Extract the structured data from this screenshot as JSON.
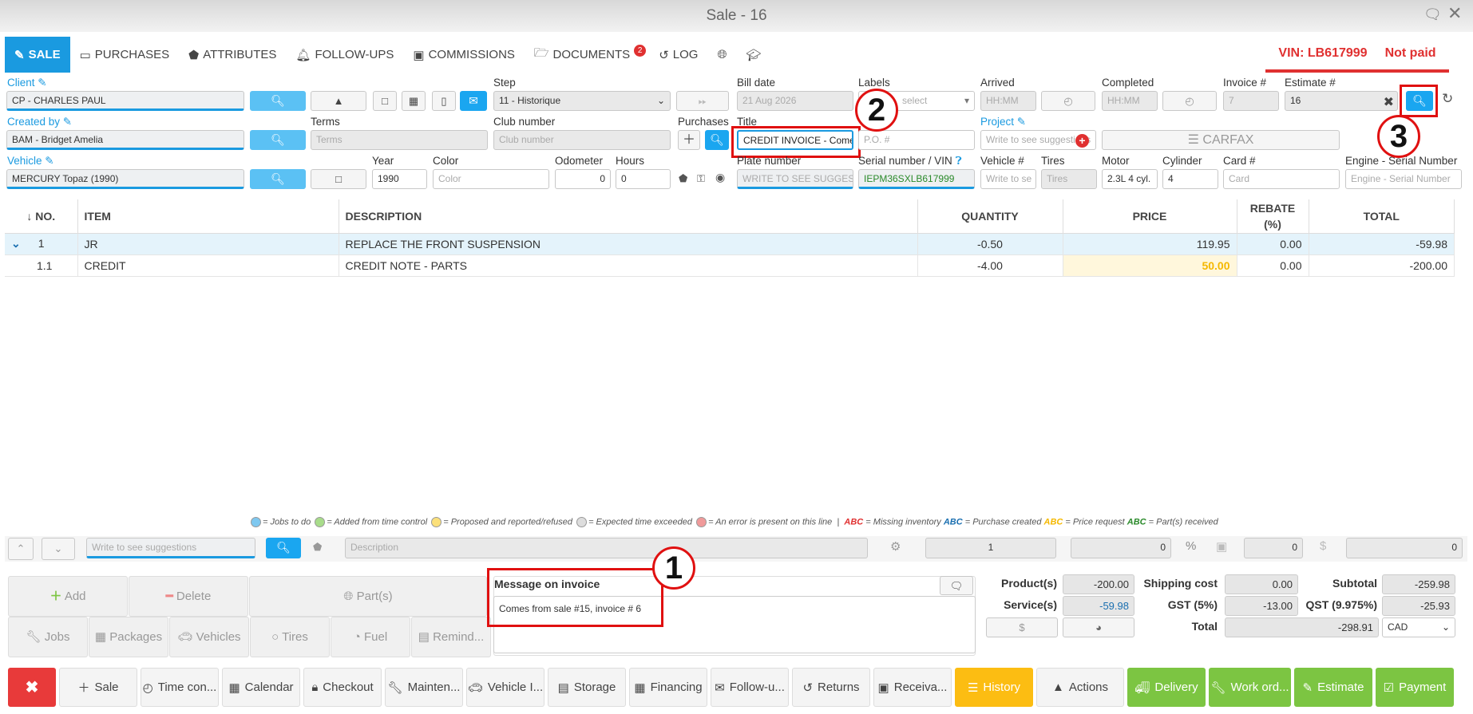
{
  "window": {
    "title": "Sale - 16"
  },
  "tabs": [
    {
      "label": "SALE",
      "icon": "edit-icon"
    },
    {
      "label": "PURCHASES",
      "icon": "credit-card-icon"
    },
    {
      "label": "ATTRIBUTES",
      "icon": "tags-icon"
    },
    {
      "label": "FOLLOW-UPS",
      "icon": "bell-icon"
    },
    {
      "label": "COMMISSIONS",
      "icon": "money-icon"
    },
    {
      "label": "DOCUMENTS",
      "icon": "folder-icon",
      "badge": "2"
    },
    {
      "label": "LOG",
      "icon": "history-icon"
    }
  ],
  "status": {
    "vin": "VIN: LB617999",
    "payment": "Not paid"
  },
  "form": {
    "client_label": "Client",
    "client_value": "CP - CHARLES PAUL",
    "step_label": "Step",
    "step_value": "11 - Historique",
    "bill_date_label": "Bill date",
    "bill_date_value": "21 Aug 2026",
    "labels_label": "Labels",
    "labels_placeholder": "select",
    "arrived_label": "Arrived",
    "arrived_placeholder": "HH:MM",
    "completed_label": "Completed",
    "completed_placeholder": "HH:MM",
    "invoice_label": "Invoice #",
    "invoice_value": "7",
    "estimate_label": "Estimate #",
    "estimate_value": "16",
    "created_by_label": "Created by",
    "created_by_value": "BAM - Bridget Amelia",
    "terms_label": "Terms",
    "terms_placeholder": "Terms",
    "club_label": "Club number",
    "club_placeholder": "Club number",
    "purchases_label": "Purchases",
    "title_label": "Title",
    "title_value": "CREDIT INVOICE - Come",
    "po_placeholder": "P.O. #",
    "project_label": "Project",
    "project_placeholder": "Write to see suggestions",
    "carfax": "CARFAX",
    "vehicle_label": "Vehicle",
    "vehicle_value": "MERCURY Topaz (1990)",
    "year_label": "Year",
    "year_value": "1990",
    "color_label": "Color",
    "color_placeholder": "Color",
    "odometer_label": "Odometer",
    "odometer_value": "0",
    "hours_label": "Hours",
    "hours_value": "0",
    "plate_label": "Plate number",
    "plate_placeholder": "WRITE TO SEE SUGGEST",
    "serial_label": "Serial number / VIN",
    "serial_value": "IEPM36SXLB617999",
    "vehicle_no_label": "Vehicle #",
    "vehicle_no_placeholder": "Write to se",
    "tires_label": "Tires",
    "tires_placeholder": "Tires",
    "motor_label": "Motor",
    "motor_value": "2.3L  4 cyl.",
    "cylinder_label": "Cylinder",
    "cylinder_value": "4",
    "card_label": "Card #",
    "card_placeholder": "Card",
    "engine_label": "Engine - Serial Number",
    "engine_placeholder": "Engine - Serial Number"
  },
  "table": {
    "headers": [
      "↓ NO.",
      "ITEM",
      "DESCRIPTION",
      "QUANTITY",
      "PRICE",
      "REBATE (%)",
      "TOTAL"
    ],
    "rows": [
      {
        "no": "1",
        "item": "JR",
        "description": "REPLACE THE FRONT SUSPENSION",
        "quantity": "-0.50",
        "price": "119.95",
        "rebate": "0.00",
        "total": "-59.98"
      },
      {
        "no": "1.1",
        "item": "CREDIT",
        "description": "CREDIT NOTE - PARTS",
        "quantity": "-4.00",
        "price": "50.00",
        "rebate": "0.00",
        "total": "-200.00"
      }
    ]
  },
  "legend": {
    "jobs": "= Jobs to do",
    "added": "= Added from time control",
    "proposed": "= Proposed and reported/refused",
    "exceeded": "= Expected time exceeded",
    "error": "= An error is present on this line",
    "sep": "|",
    "abc": "ABC",
    "missing": "= Missing inventory",
    "purchase": "= Purchase created",
    "request": "= Price request",
    "received": "= Part(s) received"
  },
  "editor": {
    "suggest_placeholder": "Write to see suggestions",
    "description_placeholder": "Description",
    "qty": "1",
    "price": "0",
    "pct_value": "0",
    "dollar_value": "0",
    "pct_symbol": "%",
    "dollar_symbol": "$"
  },
  "actions": {
    "add": "Add",
    "delete": "Delete",
    "parts": "Part(s)",
    "jobs": "Jobs",
    "packages": "Packages",
    "vehicles": "Vehicles",
    "tires": "Tires",
    "fuel": "Fuel",
    "remind": "Remind..."
  },
  "message": {
    "label": "Message on invoice",
    "value": "Comes from sale #15, invoice # 6"
  },
  "totals": {
    "products_label": "Product(s)",
    "products": "-200.00",
    "services_label": "Service(s)",
    "services": "-59.98",
    "dollar": "$",
    "shipping_label": "Shipping cost",
    "shipping": "0.00",
    "gst_label": "GST (5%)",
    "gst": "-13.00",
    "total_label": "Total",
    "total": "-298.91",
    "subtotal_label": "Subtotal",
    "subtotal": "-259.98",
    "qst_label": "QST (9.975%)",
    "qst": "-25.93",
    "currency": "CAD"
  },
  "bottom": [
    {
      "label": "Sale"
    },
    {
      "label": "Time con..."
    },
    {
      "label": "Calendar"
    },
    {
      "label": "Checkout"
    },
    {
      "label": "Mainten..."
    },
    {
      "label": "Vehicle I..."
    },
    {
      "label": "Storage"
    },
    {
      "label": "Financing"
    },
    {
      "label": "Follow-u..."
    },
    {
      "label": "Returns"
    },
    {
      "label": "Receiva..."
    },
    {
      "label": "History"
    },
    {
      "label": "Actions"
    },
    {
      "label": "Delivery"
    },
    {
      "label": "Work ord..."
    },
    {
      "label": "Estimate"
    },
    {
      "label": "Payment"
    }
  ],
  "annotations": [
    "1",
    "2",
    "3"
  ],
  "colors": {
    "accent": "#1a9ae0",
    "alert": "#e03030",
    "highlight": "#fcbd12",
    "success": "#7cc542"
  }
}
